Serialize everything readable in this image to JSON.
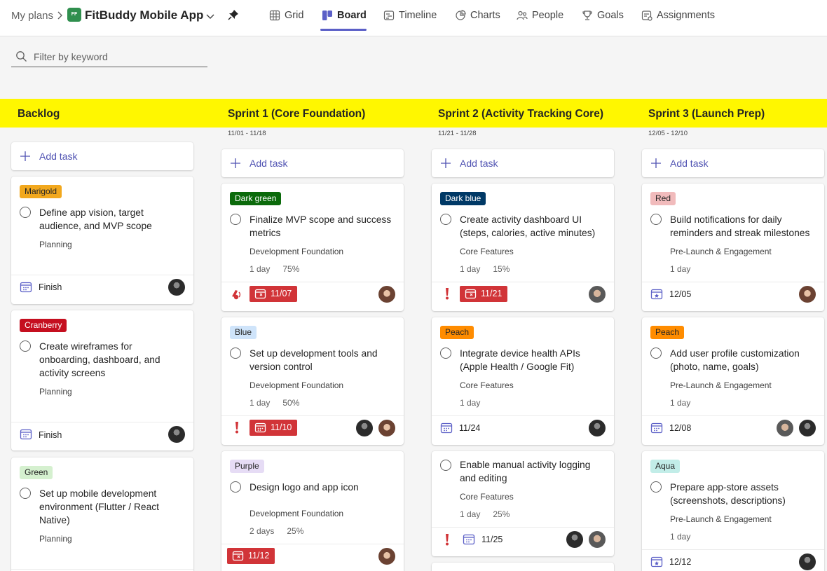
{
  "header": {
    "breadcrumb": "My plans",
    "plan_icon": "FF",
    "plan_title": "FitBuddy Mobile App",
    "tabs": [
      {
        "label": "Grid",
        "icon": "grid-icon"
      },
      {
        "label": "Board",
        "icon": "board-icon",
        "active": true
      },
      {
        "label": "Timeline",
        "icon": "timeline-icon"
      },
      {
        "label": "Charts",
        "icon": "charts-icon"
      },
      {
        "label": "People",
        "icon": "people-icon"
      },
      {
        "label": "Goals",
        "icon": "goals-icon"
      },
      {
        "label": "Assignments",
        "icon": "assignments-icon"
      }
    ]
  },
  "filter": {
    "placeholder": "Filter by keyword"
  },
  "colors": {
    "accent": "#5b5fc7",
    "band": "#fff700",
    "overdue": "#d13438"
  },
  "add_task_label": "Add task",
  "buckets": [
    {
      "name": "Backlog",
      "dates": "",
      "tasks": [
        {
          "label": "Marigold",
          "title_lines": [
            "Define app vision, target",
            "audience, and MVP scope"
          ],
          "bucket": "Planning",
          "date": "Finish"
        },
        {
          "label": "Cranberry",
          "title_lines": [
            "Create wireframes for",
            "onboarding, dashboard, and",
            "activity screens"
          ],
          "bucket": "Planning",
          "date": "Finish"
        },
        {
          "label": "Green",
          "title_lines": [
            "Set up mobile development",
            "environment (Flutter / React",
            "Native)"
          ],
          "bucket": "Planning"
        }
      ]
    },
    {
      "name": "Sprint 1 (Core Foundation)",
      "dates": "11/01 - 11/18",
      "tasks": [
        {
          "label": "Dark green",
          "title_lines": [
            "Finalize MVP scope and success",
            "metrics"
          ],
          "bucket": "Development Foundation",
          "duration": "1 day",
          "progress": "75%",
          "date": "11/07"
        },
        {
          "label": "Blue",
          "title_lines": [
            "Set up development tools and",
            "version control"
          ],
          "bucket": "Development Foundation",
          "duration": "1 day",
          "progress": "50%",
          "date": "11/10"
        },
        {
          "label": "Purple",
          "title_lines": [
            "Design logo and app icon"
          ],
          "bucket": "Development Foundation",
          "duration": "2 days",
          "progress": "25%",
          "date": "11/12"
        }
      ]
    },
    {
      "name": "Sprint 2 (Activity Tracking Core)",
      "dates": "11/21 - 11/28",
      "tasks": [
        {
          "label": "Dark blue",
          "title_lines": [
            "Create activity dashboard UI",
            "(steps, calories, active minutes)"
          ],
          "bucket": "Core Features",
          "duration": "1 day",
          "progress": "15%",
          "date": "11/21"
        },
        {
          "label": "Peach",
          "title_lines": [
            "Integrate device health APIs",
            "(Apple Health / Google Fit)"
          ],
          "bucket": "Core Features",
          "duration": "1 day",
          "date": "11/24"
        },
        {
          "title_lines": [
            "Enable manual activity logging",
            "and editing"
          ],
          "bucket": "Core Features",
          "duration": "1 day",
          "progress": "25%",
          "date": "11/25"
        }
      ]
    },
    {
      "name": "Sprint 3 (Launch Prep)",
      "dates": "12/05 - 12/10",
      "tasks": [
        {
          "label": "Red",
          "title_lines": [
            "Build notifications for daily",
            "reminders and streak milestones"
          ],
          "bucket": "Pre-Launch & Engagement",
          "duration": "1 day",
          "date": "12/05"
        },
        {
          "label": "Peach",
          "title_lines": [
            "Add user profile customization",
            "(photo, name, goals)"
          ],
          "bucket": "Pre-Launch & Engagement",
          "duration": "1 day",
          "date": "12/08"
        },
        {
          "label": "Aqua",
          "title_lines": [
            "Prepare app-store assets",
            "(screenshots, descriptions)"
          ],
          "bucket": "Pre-Launch & Engagement",
          "duration": "1 day",
          "date": "12/12"
        }
      ]
    }
  ]
}
